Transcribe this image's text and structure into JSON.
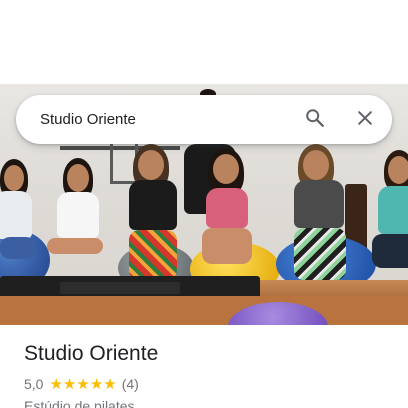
{
  "search": {
    "query": "Studio Oriente",
    "search_icon": "search-icon",
    "close_icon": "close-icon"
  },
  "photo": {
    "subject": "group-photo"
  },
  "place": {
    "name": "Studio Oriente",
    "rating": "5,0",
    "stars": 5,
    "review_count": "(4)",
    "category": "Estúdio de pilates"
  },
  "colors": {
    "star": "#fbbc04",
    "text_primary": "#202124",
    "text_secondary": "#70757a"
  }
}
